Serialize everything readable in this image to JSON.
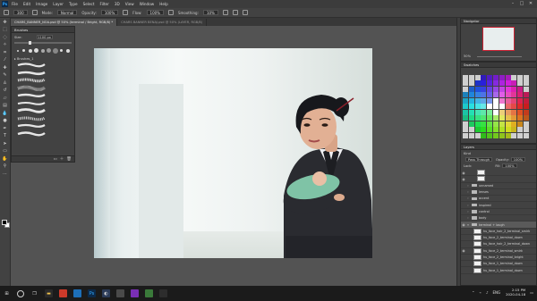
{
  "app": {
    "logo": "Ps"
  },
  "menu": [
    "File",
    "Edit",
    "Image",
    "Layer",
    "Type",
    "Select",
    "Filter",
    "3D",
    "View",
    "Window",
    "Help"
  ],
  "window_controls": {
    "minimize": "–",
    "maximize": "□",
    "close": "✕"
  },
  "options": {
    "size": "300",
    "mode_label": "Mode:",
    "mode_value": "Normal",
    "opacity_label": "Opacity:",
    "opacity_value": "100%",
    "flow_label": "Flow:",
    "flow_value": "100%",
    "smoothing_label": "Smoothing:",
    "smoothing_value": "10%"
  },
  "doc_tabs": [
    "CHARS_BANNER_NOA.psd @ 50% (terminal / Bright, RGB/8) *",
    "CHARS BANNER BENAJ.psd @ 50% (LAYER, RGB/8)"
  ],
  "brushes_panel": {
    "title": "Brushes",
    "size_label": "Size:",
    "size_value": "1100 px",
    "folder_label": "Brushes_1",
    "footer_icons": [
      "folder-icon",
      "add-icon",
      "trash-icon"
    ]
  },
  "navigator": {
    "title": "Navigator",
    "zoom": "50%"
  },
  "swatches": {
    "title": "Swatches"
  },
  "layers_panel": {
    "title": "Layers",
    "kind_label": "Kind",
    "blend_mode": "Pass Through",
    "opacity_label": "Opacity:",
    "opacity_value": "100%",
    "lock_label": "Lock:",
    "fill_label": "Fill:",
    "fill_value": "100%",
    "rows": [
      {
        "name": "",
        "type": "layer",
        "visible": true
      },
      {
        "name": "",
        "type": "layer",
        "visible": true
      },
      {
        "name": "unnamed",
        "type": "folder",
        "visible": false
      },
      {
        "name": "lenses",
        "type": "folder",
        "visible": false
      },
      {
        "name": "accent",
        "type": "folder",
        "visible": false
      },
      {
        "name": "inspired",
        "type": "folder",
        "visible": false
      },
      {
        "name": "control",
        "type": "folder",
        "visible": false
      },
      {
        "name": "body",
        "type": "folder",
        "visible": false
      },
      {
        "name": "terminal + laugh",
        "type": "folder",
        "visible": true,
        "selected": true
      },
      {
        "name": "hu_face_hair_2_terminal_smirk",
        "type": "layer",
        "visible": false
      },
      {
        "name": "hu_face_2_terminal_down",
        "type": "layer",
        "visible": false
      },
      {
        "name": "hu_face_hair_2_terminal_down",
        "type": "layer",
        "visible": false
      },
      {
        "name": "hu_face_2_terminal_smirk",
        "type": "layer",
        "visible": true
      },
      {
        "name": "hu_face_2_terminal_bright",
        "type": "layer",
        "visible": false
      },
      {
        "name": "hu_face_1_terminal_down",
        "type": "layer",
        "visible": false
      },
      {
        "name": "hu_face_1_terminal_down",
        "type": "layer",
        "visible": false
      }
    ]
  },
  "taskbar": {
    "tray_text": "ENG",
    "time": "2:15 PM",
    "date": "2020-04-18"
  },
  "colors": {
    "menubar": "#3c3c3c",
    "panel": "#424242",
    "workspace": "#535353",
    "taskbar": "#1b1b1b",
    "accent": "#31a8ff"
  }
}
